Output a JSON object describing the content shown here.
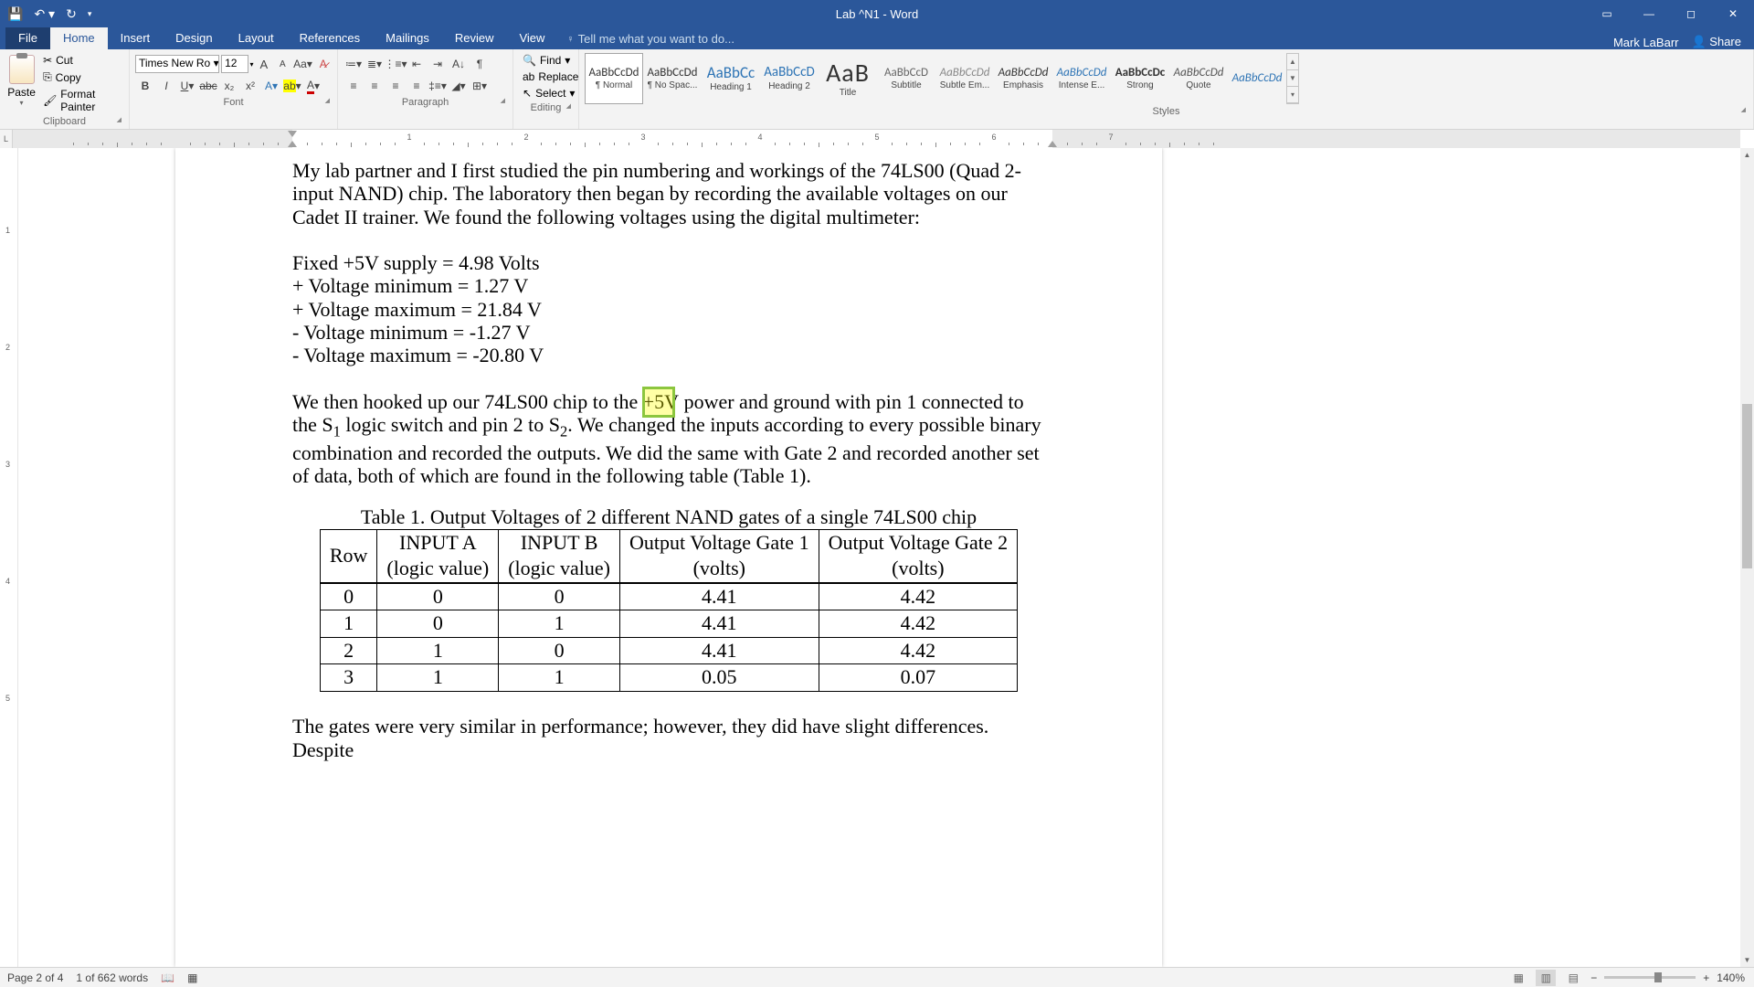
{
  "window": {
    "title": "Lab ^N1 - Word",
    "user": "Mark LaBarr",
    "share": "Share"
  },
  "qat": {
    "save": "save-icon",
    "undo": "undo-icon",
    "redo": "redo-icon"
  },
  "tabs": {
    "file": "File",
    "home": "Home",
    "insert": "Insert",
    "design": "Design",
    "layout": "Layout",
    "references": "References",
    "mailings": "Mailings",
    "review": "Review",
    "view": "View",
    "tell_me": "Tell me what you want to do..."
  },
  "clipboard": {
    "paste": "Paste",
    "cut": "Cut",
    "copy": "Copy",
    "format_painter": "Format Painter",
    "label": "Clipboard"
  },
  "font": {
    "name": "Times New Ro",
    "size": "12",
    "label": "Font"
  },
  "paragraph": {
    "label": "Paragraph"
  },
  "editing": {
    "find": "Find",
    "replace": "Replace",
    "select": "Select",
    "label": "Editing"
  },
  "styles": {
    "label": "Styles",
    "items": [
      {
        "sample": "AaBbCcDd",
        "name": "¶ Normal",
        "sel": true,
        "css": "font-size:13px;"
      },
      {
        "sample": "AaBbCcDd",
        "name": "¶ No Spac...",
        "css": "font-size:13px;"
      },
      {
        "sample": "AaBbCc",
        "name": "Heading 1",
        "css": "font-size:17px;color:#2e74b5;"
      },
      {
        "sample": "AaBbCcD",
        "name": "Heading 2",
        "css": "font-size:15px;color:#2e74b5;"
      },
      {
        "sample": "AaB",
        "name": "Title",
        "css": "font-size:28px;letter-spacing:1px;"
      },
      {
        "sample": "AaBbCcD",
        "name": "Subtitle",
        "css": "font-size:13px;color:#666;"
      },
      {
        "sample": "AaBbCcDd",
        "name": "Subtle Em...",
        "css": "font-size:13px;color:#888;font-style:italic;"
      },
      {
        "sample": "AaBbCcDd",
        "name": "Emphasis",
        "css": "font-size:13px;font-style:italic;"
      },
      {
        "sample": "AaBbCcDd",
        "name": "Intense E...",
        "css": "font-size:13px;color:#2e74b5;font-style:italic;"
      },
      {
        "sample": "AaBbCcDc",
        "name": "Strong",
        "css": "font-size:13px;font-weight:bold;"
      },
      {
        "sample": "AaBbCcDd",
        "name": "Quote",
        "css": "font-size:13px;font-style:italic;color:#555;"
      },
      {
        "sample": "AaBbCcDd",
        "name": "",
        "css": "font-size:13px;font-style:italic;color:#2e74b5;"
      }
    ]
  },
  "document": {
    "p1": "My lab partner and I first studied the pin numbering and workings of the 74LS00 (Quad 2-input NAND) chip. The laboratory then began by recording the available voltages on our Cadet II trainer. We found the following voltages using the digital multimeter:",
    "m1": "Fixed +5V supply = 4.98 Volts",
    "m2": "+ Voltage minimum = 1.27 V",
    "m3": "+ Voltage maximum = 21.84 V",
    "m4": "- Voltage minimum = -1.27 V",
    "m5": "- Voltage maximum = -20.80 V",
    "p2a": "We then hooked up our 74LS00 chip to the +5V",
    "p2b": " power and ground with pin 1 connected to the S",
    "p2c": " logic switch and pin 2 to S",
    "p2d": ". We changed the inputs according to every possible binary combination and recorded the outputs. We did the same with Gate 2 and recorded another set of data, both of which are found in the following table (Table 1).",
    "caption": "Table 1. Output Voltages of 2 different NAND gates of a single 74LS00 chip",
    "p3": "The gates were very similar in performance; however, they did have slight differences. Despite"
  },
  "chart_data": {
    "type": "table",
    "title": "Table 1. Output Voltages of 2 different NAND gates of a single 74LS00 chip",
    "columns": [
      "Row",
      "INPUT A (logic value)",
      "INPUT B (logic value)",
      "Output Voltage Gate 1 (volts)",
      "Output Voltage Gate 2 (volts)"
    ],
    "rows": [
      [
        "0",
        "0",
        "0",
        "4.41",
        "4.42"
      ],
      [
        "1",
        "0",
        "1",
        "4.41",
        "4.42"
      ],
      [
        "2",
        "1",
        "0",
        "4.41",
        "4.42"
      ],
      [
        "3",
        "1",
        "1",
        "0.05",
        "0.07"
      ]
    ],
    "head": {
      "row": "Row",
      "a1": "INPUT A",
      "a2": "(logic value)",
      "b1": "INPUT B",
      "b2": "(logic value)",
      "g1a": "Output Voltage Gate 1",
      "g1b": "(volts)",
      "g2a": "Output Voltage Gate 2",
      "g2b": "(volts)"
    }
  },
  "ruler": {
    "nums": [
      "1",
      "2",
      "3",
      "4",
      "5",
      "6",
      "7"
    ]
  },
  "status": {
    "page": "Page 2 of 4",
    "words": "1 of 662 words",
    "zoom": "140%"
  }
}
